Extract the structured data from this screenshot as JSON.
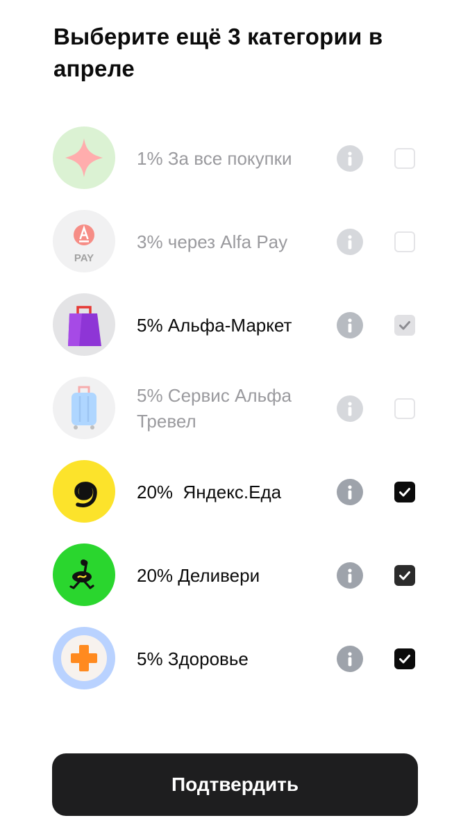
{
  "title": "Выберите ещё 3 категории в апреле",
  "categories": [
    {
      "label": "1% За все покупки",
      "icon": "star-icon",
      "state": "disabled",
      "checked": false
    },
    {
      "label": "3% через Alfa Pay",
      "icon": "alfa-pay-icon",
      "icon_text": "PAY",
      "state": "disabled",
      "checked": false
    },
    {
      "label": "5% Альфа-Маркет",
      "icon": "shopping-bag-icon",
      "state": "locked",
      "checked": true
    },
    {
      "label": "5% Сервис Альфа Тревел",
      "icon": "suitcase-icon",
      "state": "disabled",
      "checked": false
    },
    {
      "label": "20%  Яндекс.Еда",
      "icon": "spiral-icon",
      "state": "active",
      "checked": true
    },
    {
      "label": "20% Деливери",
      "icon": "ostrich-icon",
      "state": "active",
      "checked": true
    },
    {
      "label": "5% Здоровье",
      "icon": "medical-cross-icon",
      "state": "active",
      "checked": true
    }
  ],
  "confirm_label": "Подтвердить",
  "colors": {
    "button_bg": "#1e1e1f",
    "checkbox_on": "#0b0b0b",
    "info_icon": "#9ea3ab",
    "muted_text": "#9a9a9e"
  }
}
